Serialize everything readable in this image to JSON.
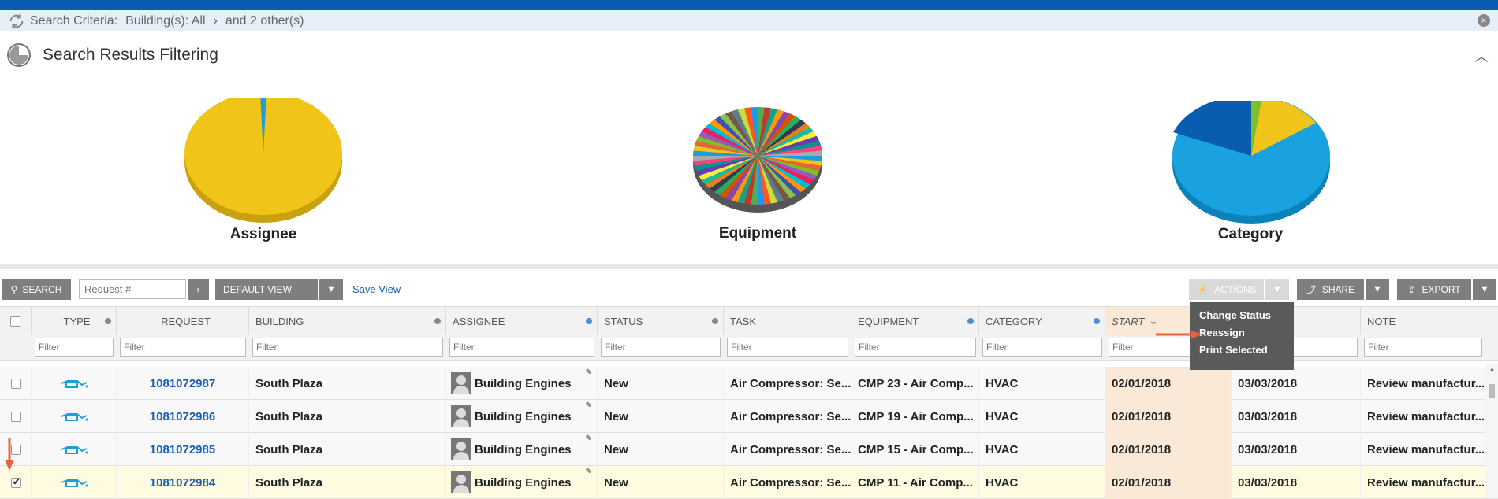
{
  "criteria": {
    "label": "Search Criteria:",
    "buildings": "Building(s): All",
    "others": "and 2 other(s)"
  },
  "filtering": {
    "title": "Search Results Filtering"
  },
  "charts": {
    "assignee_label": "Assignee",
    "equipment_label": "Equipment",
    "category_label": "Category"
  },
  "chart_data": [
    {
      "type": "pie",
      "title": "Assignee",
      "slices": [
        {
          "value": 98.5,
          "color": "#f0c419"
        },
        {
          "value": 1.5,
          "color": "#1a9fdc"
        }
      ]
    },
    {
      "type": "pie",
      "title": "Equipment",
      "slices": "many small slices (multi-colored)"
    },
    {
      "type": "pie",
      "title": "Category",
      "slices": [
        {
          "value": 66,
          "color": "#1aa1e0"
        },
        {
          "value": 16,
          "color": "#0a5cb0"
        },
        {
          "value": 2,
          "color": "#7cbf2b"
        },
        {
          "value": 16,
          "color": "#f0c419"
        }
      ]
    }
  ],
  "toolbar": {
    "search_label": "SEARCH",
    "request_placeholder": "Request #",
    "view_label": "DEFAULT VIEW",
    "save_view": "Save View",
    "actions_label": "ACTIONS",
    "share_label": "SHARE",
    "export_label": "EXPORT"
  },
  "columns": {
    "type": "TYPE",
    "request": "REQUEST",
    "building": "BUILDING",
    "assignee": "ASSIGNEE",
    "status": "STATUS",
    "task": "TASK",
    "equipment": "EQUIPMENT",
    "category": "CATEGORY",
    "start": "START",
    "note": "NOTE",
    "filter_placeholder": "Filter"
  },
  "actions_menu": {
    "change_status": "Change Status",
    "reassign": "Reassign",
    "print_selected": "Print Selected"
  },
  "rows": [
    {
      "request": "1081072987",
      "building": "South Plaza",
      "assignee": "Building Engines",
      "status": "New",
      "task": "Air Compressor: Se...",
      "equipment": "CMP 23 - Air Comp...",
      "category": "HVAC",
      "start": "02/01/2018",
      "due": "03/03/2018",
      "note": "Review manufactur..."
    },
    {
      "request": "1081072986",
      "building": "South Plaza",
      "assignee": "Building Engines",
      "status": "New",
      "task": "Air Compressor: Se...",
      "equipment": "CMP 19 - Air Comp...",
      "category": "HVAC",
      "start": "02/01/2018",
      "due": "03/03/2018",
      "note": "Review manufactur..."
    },
    {
      "request": "1081072985",
      "building": "South Plaza",
      "assignee": "Building Engines",
      "status": "New",
      "task": "Air Compressor: Se...",
      "equipment": "CMP 15 - Air Comp...",
      "category": "HVAC",
      "start": "02/01/2018",
      "due": "03/03/2018",
      "note": "Review manufactur..."
    },
    {
      "request": "1081072984",
      "building": "South Plaza",
      "assignee": "Building Engines",
      "status": "New",
      "task": "Air Compressor: Se...",
      "equipment": "CMP 11 - Air Comp...",
      "category": "HVAC",
      "start": "02/01/2018",
      "due": "03/03/2018",
      "note": "Review manufactur..."
    }
  ]
}
